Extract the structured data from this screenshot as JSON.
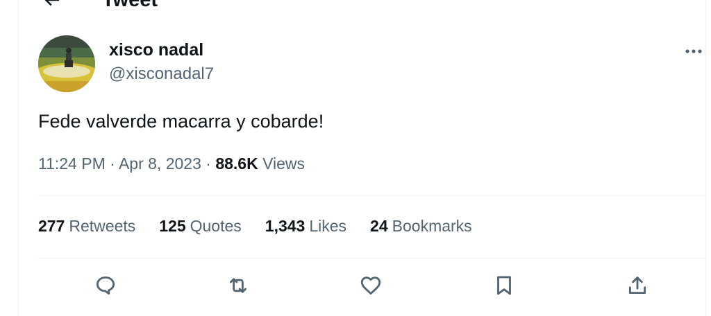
{
  "header": {
    "title": "Tweet",
    "back_icon": "arrow-left-icon"
  },
  "author": {
    "name": "xisco nadal",
    "handle": "@xisconadal7",
    "avatar": "avatar-photo"
  },
  "more_icon": "more-horizontal-icon",
  "tweet": {
    "text": "Fede valverde macarra y cobarde!"
  },
  "meta": {
    "time": "11:24 PM",
    "date": "Apr 8, 2023",
    "views_count": "88.6K",
    "views_label": "Views",
    "separator": "·"
  },
  "stats": [
    {
      "count": "277",
      "label": "Retweets"
    },
    {
      "count": "125",
      "label": "Quotes"
    },
    {
      "count": "1,343",
      "label": "Likes"
    },
    {
      "count": "24",
      "label": "Bookmarks"
    }
  ],
  "actions": [
    {
      "name": "reply",
      "icon": "reply-icon"
    },
    {
      "name": "retweet",
      "icon": "retweet-icon"
    },
    {
      "name": "like",
      "icon": "heart-icon"
    },
    {
      "name": "bookmark",
      "icon": "bookmark-icon"
    },
    {
      "name": "share",
      "icon": "share-icon"
    }
  ],
  "colors": {
    "text": "#0f1419",
    "secondary": "#536471",
    "divider": "#eff3f4"
  }
}
